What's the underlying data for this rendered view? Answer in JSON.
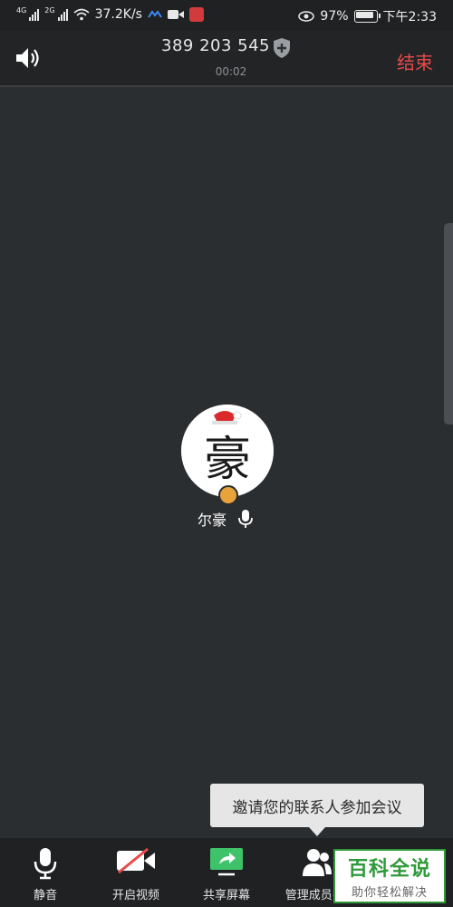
{
  "status_bar": {
    "network_1": "4G",
    "network_2": "2G",
    "speed": "37.2K/s",
    "battery": "97%",
    "time": "下午2:33"
  },
  "header": {
    "meeting_id": "389 203 545",
    "timer": "00:02",
    "end_label": "结束"
  },
  "participant": {
    "name": "尔豪",
    "avatar_glyph": "豪"
  },
  "tooltip": {
    "text": "邀请您的联系人参加会议"
  },
  "toolbar": {
    "items": [
      {
        "label": "静音",
        "icon": "microphone-icon"
      },
      {
        "label": "开启视频",
        "icon": "video-off-icon"
      },
      {
        "label": "共享屏幕",
        "icon": "share-screen-icon"
      },
      {
        "label": "管理成员(1)",
        "icon": "participants-icon"
      }
    ]
  },
  "watermark": {
    "title": "百科全说",
    "subtitle": "助你轻松解决"
  },
  "colors": {
    "background": "#2b2e31",
    "end_red": "#e84a4a",
    "share_green": "#3ec36b",
    "watermark_green": "#2f9a3a"
  }
}
